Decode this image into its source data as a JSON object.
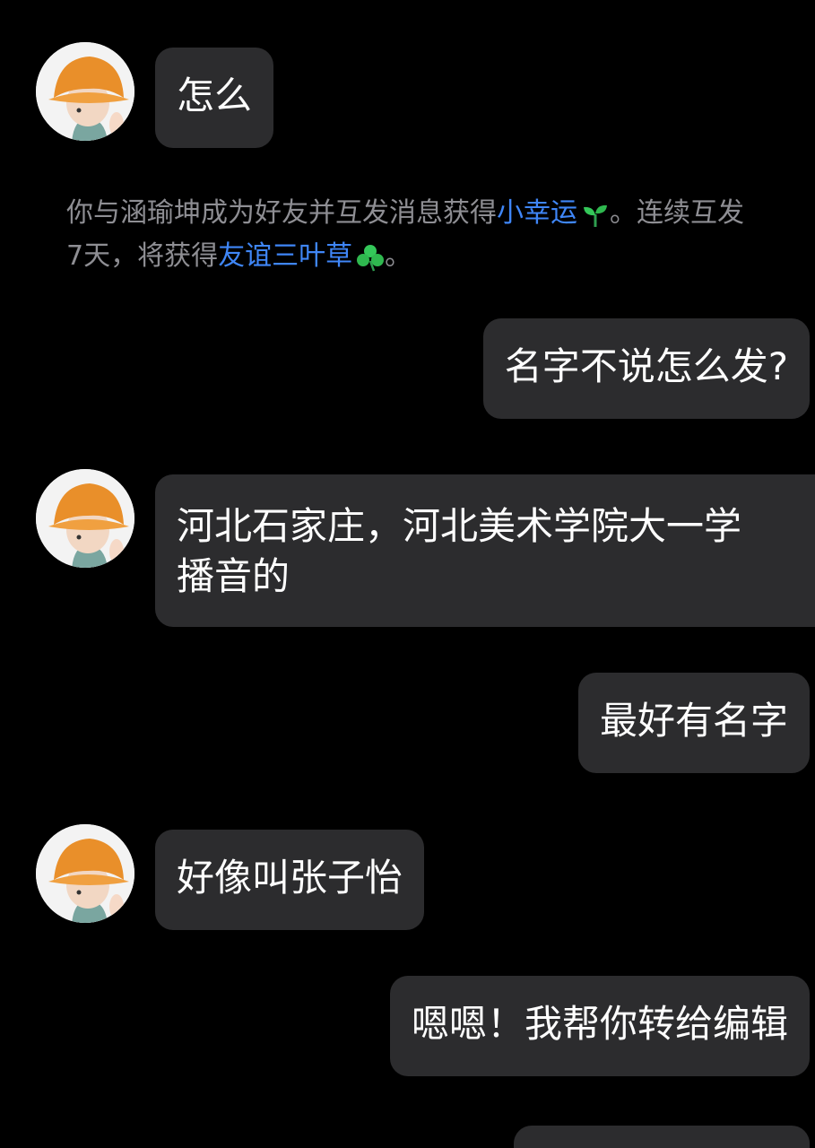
{
  "messages": [
    {
      "side": "left",
      "text": "怎么"
    },
    {
      "side": "right",
      "text": "名字不说怎么发?"
    },
    {
      "side": "left",
      "line1": "河北石家庄，河北美术学院大一学",
      "line2": "播音的"
    },
    {
      "side": "right",
      "text": "最好有名字"
    },
    {
      "side": "left",
      "text": "好像叫张子怡"
    },
    {
      "side": "right",
      "text": "嗯嗯！我帮你转给编辑"
    }
  ],
  "system_notice": {
    "prefix": "你与涵瑜坤成为好友并互发消息获得",
    "link1": "小幸运",
    "middle": "。连续互发",
    "line2_prefix": "7天，将获得",
    "link2": "友谊三叶草",
    "suffix": "。"
  },
  "colors": {
    "background": "#000000",
    "bubble": "#2c2c2e",
    "system_text": "#8e8e93",
    "link": "#3f86f7",
    "clover_green": "#34c759"
  },
  "icons": [
    "sprout-icon",
    "clover-icon",
    "avatar-hardhat"
  ]
}
